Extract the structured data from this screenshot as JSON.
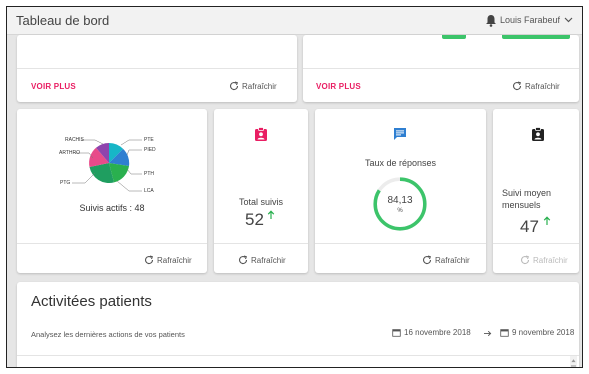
{
  "header": {
    "title": "Tableau de bord",
    "user_name": "Louis Farabeuf"
  },
  "top_cards": {
    "left": {
      "voir_plus": "VOIR PLUS",
      "refresh": "Rafraîchir"
    },
    "right": {
      "voir_plus": "VOIR PLUS",
      "refresh": "Rafraîchir"
    }
  },
  "suivis_actifs": {
    "title": "Suivis actifs : 48",
    "refresh": "Rafraîchir",
    "pie_labels": [
      "RACHIS",
      "ARTHRO",
      "PTG",
      "PTE",
      "PIED",
      "PTH",
      "LCA"
    ],
    "pie_colors": [
      "#17b6c7",
      "#2f7fd1",
      "#2ab04f",
      "#e84b8a",
      "#8e44ad"
    ]
  },
  "total_suivis": {
    "label": "Total suivis",
    "value": "52",
    "refresh": "Rafraîchir",
    "icon": "clipboard-user-icon",
    "icon_color": "#e91e63"
  },
  "taux_reponses": {
    "label": "Taux de réponses",
    "value": "84,13",
    "unit": "%",
    "percent": 84.13,
    "refresh": "Rafraîchir",
    "icon": "message-icon",
    "icon_color": "#2f7fd1",
    "gauge_color": "#3cc46a"
  },
  "suivi_moyen": {
    "label_line1": "Suivi moyen",
    "label_line2": "mensuels",
    "value": "47",
    "refresh": "Rafraîchir",
    "icon": "clipboard-user-icon",
    "icon_color": "#222222"
  },
  "activites": {
    "title": "Activitées patients",
    "subtitle": "Analysez les dernières actions de vos patients",
    "date_from": "16 novembre 2018",
    "date_to": "9 novembre 2018"
  }
}
